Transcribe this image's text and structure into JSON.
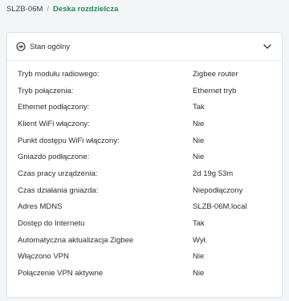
{
  "breadcrumb": {
    "device": "SLZB-06M",
    "separator": "/",
    "current": "Deska rozdzielcza"
  },
  "card": {
    "title": "Stan ogólny",
    "icon": "dashboard-gauge-icon",
    "toggle_icon": "chevron-down-icon",
    "rows": [
      {
        "label": "Tryb modułu radiowego:",
        "value": "Zigbee router"
      },
      {
        "label": "Tryb połączenia:",
        "value": "Ethernet tryb"
      },
      {
        "label": "Ethernet podłączony:",
        "value": "Tak"
      },
      {
        "label": "Klient WiFi włączony:",
        "value": "Nie"
      },
      {
        "label": "Punkt dostępu WiFi włączony:",
        "value": "Nie"
      },
      {
        "label": "Gniazdo podłączone:",
        "value": "Nie"
      },
      {
        "label": "Czas pracy urządzenia:",
        "value": "2d 19g 53m"
      },
      {
        "label": "Czas działania gniazda:",
        "value": "Niepodłączony"
      },
      {
        "label": "Adres MDNS",
        "value": "SLZB-06M.local"
      },
      {
        "label": "Dostęp do Internetu",
        "value": "Tak"
      },
      {
        "label": "Automatyczna aktualizacja Zigbee",
        "value": "Wył."
      },
      {
        "label": "Włączono VPN",
        "value": "Nie"
      },
      {
        "label": "Połączenie VPN aktywne",
        "value": "Nie"
      }
    ]
  },
  "colors": {
    "accent": "#1f8a57",
    "background": "#f4f5f7",
    "card": "#ffffff",
    "border": "#dfe2e6"
  }
}
